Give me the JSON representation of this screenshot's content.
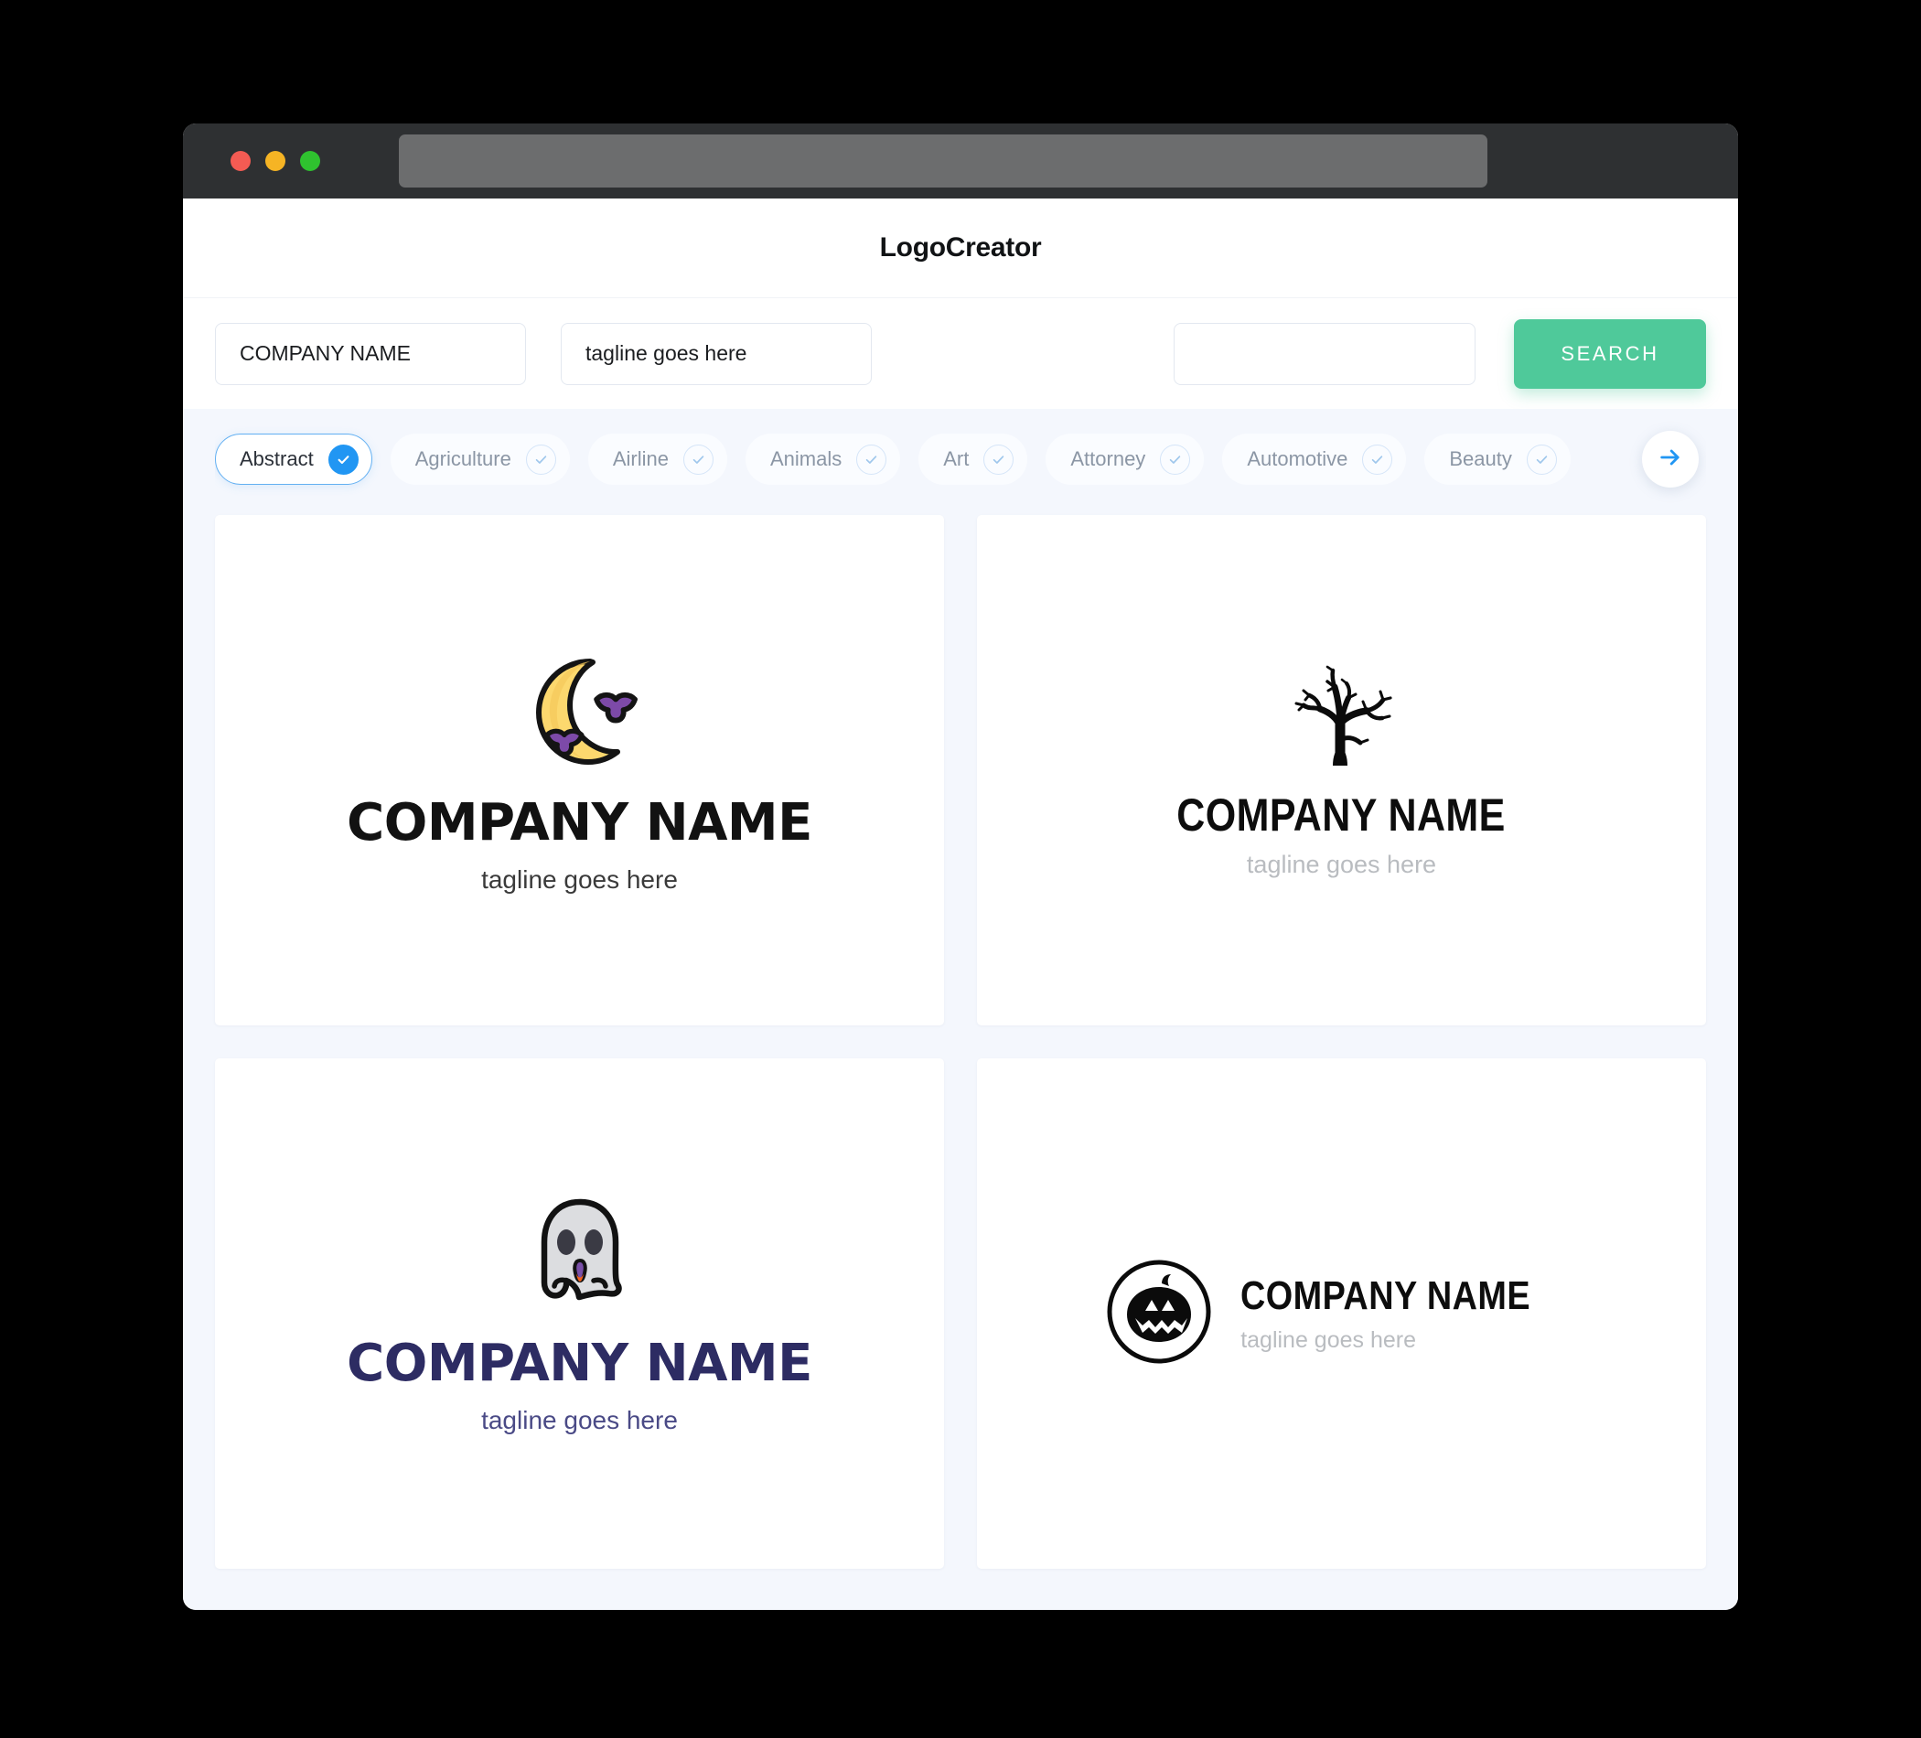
{
  "window": {
    "traffic_lights": [
      "close",
      "minimize",
      "maximize"
    ],
    "url_value": ""
  },
  "header": {
    "app_title": "LogoCreator"
  },
  "search": {
    "company_value": "COMPANY NAME",
    "company_placeholder": "COMPANY NAME",
    "tagline_value": "tagline goes here",
    "tagline_placeholder": "tagline goes here",
    "keyword_value": "",
    "keyword_placeholder": "",
    "button_label": "SEARCH",
    "button_color": "#4fc99a"
  },
  "categories": {
    "selected": "Abstract",
    "accent_color": "#2196f3",
    "next_label": "next-categories",
    "items": [
      {
        "label": "Abstract",
        "selected": true
      },
      {
        "label": "Agriculture",
        "selected": false
      },
      {
        "label": "Airline",
        "selected": false
      },
      {
        "label": "Animals",
        "selected": false
      },
      {
        "label": "Art",
        "selected": false
      },
      {
        "label": "Attorney",
        "selected": false
      },
      {
        "label": "Automotive",
        "selected": false
      },
      {
        "label": "Beauty",
        "selected": false
      }
    ]
  },
  "results": {
    "cards": [
      {
        "icon": "crescent-moon-with-bats-icon",
        "name": "COMPANY NAME",
        "tagline": "tagline goes here",
        "name_color": "#121212",
        "tagline_color": "#3a3a3a",
        "layout": "stacked"
      },
      {
        "icon": "bare-tree-icon",
        "name": "COMPANY NAME",
        "tagline": "tagline goes here",
        "name_color": "#0d0d0d",
        "tagline_color": "#b9bcc0",
        "layout": "stacked"
      },
      {
        "icon": "ghost-icon",
        "name": "COMPANY NAME",
        "tagline": "tagline goes here",
        "name_color": "#2d2c63",
        "tagline_color": "#4a4a86",
        "layout": "stacked"
      },
      {
        "icon": "jack-o-lantern-icon",
        "name": "COMPANY NAME",
        "tagline": "tagline goes here",
        "name_color": "#0d0d0d",
        "tagline_color": "#b9bcc0",
        "layout": "horizontal"
      }
    ]
  }
}
